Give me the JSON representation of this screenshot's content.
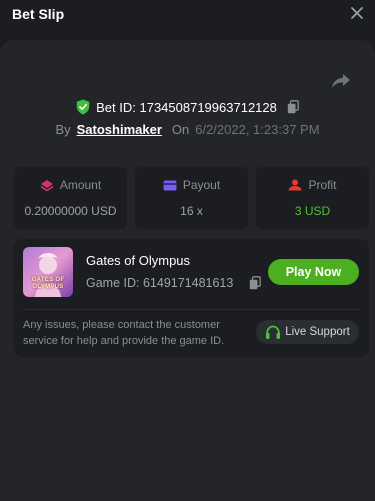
{
  "header": {
    "title": "Bet Slip"
  },
  "bet": {
    "id_text": "Bet ID: 1734508719963712128",
    "by_label": "By",
    "user": "Satoshimaker",
    "on_label": "On",
    "date": "6/2/2022, 1:23:37 PM"
  },
  "stats": {
    "amount": {
      "label": "Amount",
      "value": "0.20000000 USD"
    },
    "payout": {
      "label": "Payout",
      "value": "16 x"
    },
    "profit": {
      "label": "Profit",
      "value": "3 USD"
    }
  },
  "game": {
    "name": "Gates of Olympus",
    "id_text": "Game ID: 6149171481613",
    "thumb_line1": "GATES OF",
    "thumb_line2": "OLYMPUS",
    "play_label": "Play Now"
  },
  "notice": {
    "text": "Any issues, please contact the customer service for help and provide the game ID.",
    "support_label": "Live Support"
  },
  "colors": {
    "accent_green": "#4caf1f",
    "profit_green": "#4cc433",
    "shield_green": "#3fbf3a",
    "amount_icon": "#d6336c",
    "payout_icon": "#7b5cf0",
    "profit_icon": "#e53935"
  },
  "icons": [
    "close-icon",
    "share-icon",
    "shield-check-icon",
    "copy-icon",
    "amount-icon",
    "payout-card-icon",
    "profit-icon",
    "headset-icon"
  ]
}
